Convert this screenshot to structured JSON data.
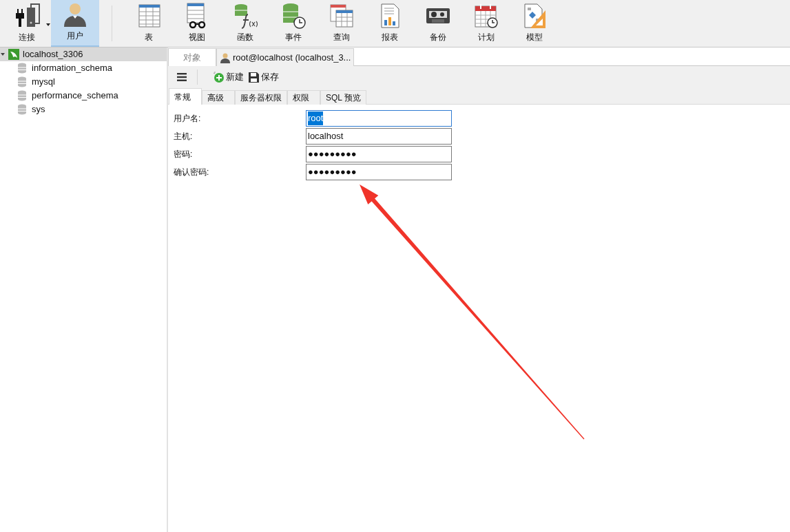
{
  "toolbar": {
    "items": [
      {
        "label": "连接",
        "kind": "connect",
        "selected": false,
        "dropdown": true
      },
      {
        "label": "用户",
        "kind": "user",
        "selected": true,
        "dropdown": false
      },
      {
        "label": "表",
        "kind": "table",
        "selected": false,
        "dropdown": false
      },
      {
        "label": "视图",
        "kind": "view",
        "selected": false,
        "dropdown": false
      },
      {
        "label": "函数",
        "kind": "function",
        "selected": false,
        "dropdown": false
      },
      {
        "label": "事件",
        "kind": "event",
        "selected": false,
        "dropdown": false
      },
      {
        "label": "查询",
        "kind": "query",
        "selected": false,
        "dropdown": false
      },
      {
        "label": "报表",
        "kind": "report",
        "selected": false,
        "dropdown": false
      },
      {
        "label": "备份",
        "kind": "backup",
        "selected": false,
        "dropdown": false
      },
      {
        "label": "计划",
        "kind": "schedule",
        "selected": false,
        "dropdown": false
      },
      {
        "label": "模型",
        "kind": "model",
        "selected": false,
        "dropdown": false
      }
    ]
  },
  "sidebar": {
    "items": [
      {
        "label": "localhost_3306",
        "selected": true,
        "expanded": true,
        "children": [
          {
            "label": "information_schema"
          },
          {
            "label": "mysql"
          },
          {
            "label": "performance_schema"
          },
          {
            "label": "sys"
          }
        ]
      }
    ]
  },
  "tabs": [
    {
      "label": "对象",
      "kind": "plain",
      "selected": false
    },
    {
      "label": "root@localhost (localhost_3...",
      "kind": "user",
      "selected": true
    }
  ],
  "actions": [
    {
      "label": "新建",
      "kind": "new"
    },
    {
      "label": "保存",
      "kind": "save"
    }
  ],
  "subtabs": [
    {
      "label": "常规",
      "selected": true
    },
    {
      "label": "高级",
      "selected": false
    },
    {
      "label": "服务器权限",
      "selected": false
    },
    {
      "label": "权限",
      "selected": false
    },
    {
      "label": "SQL 预览",
      "selected": false
    }
  ],
  "form": {
    "fields": [
      {
        "label": "用户名:",
        "value": "root",
        "focused": true
      },
      {
        "label": "主机:",
        "value": "localhost",
        "focused": false
      },
      {
        "label": "密码:",
        "value": "●●●●●●●●●",
        "focused": false
      },
      {
        "label": "确认密码:",
        "value": "●●●●●●●●●",
        "focused": false
      }
    ]
  }
}
